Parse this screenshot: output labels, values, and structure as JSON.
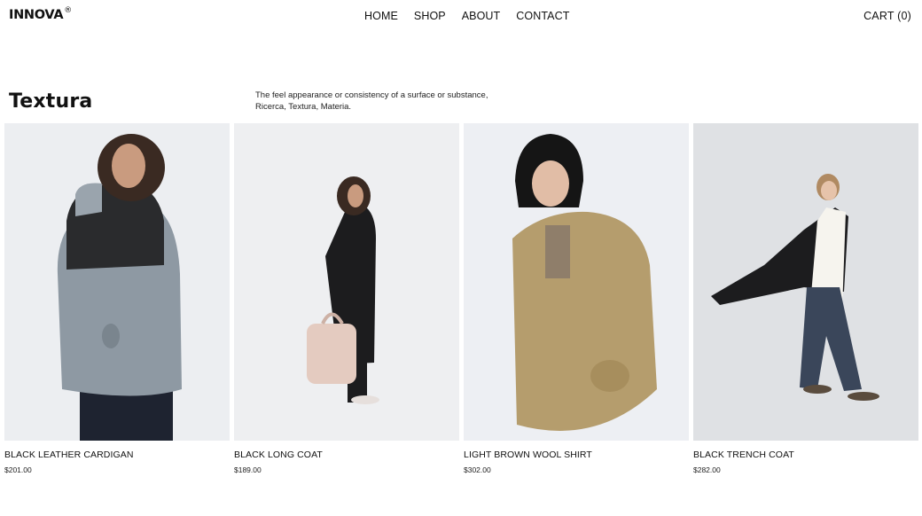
{
  "brand": {
    "name": "INNOVA",
    "mark": "®"
  },
  "nav": {
    "items": [
      "HOME",
      "SHOP",
      "ABOUT",
      "CONTACT"
    ]
  },
  "cart": {
    "label": "CART (0)"
  },
  "collection": {
    "title": "Textura",
    "description_line1": "The feel appearance or consistency of a surface or substance,",
    "description_line2": "Ricerca, Textura, Materia."
  },
  "products": [
    {
      "name": "BLACK LEATHER CARDIGAN",
      "price": "$201.00"
    },
    {
      "name": "BLACK LONG COAT",
      "price": "$189.00"
    },
    {
      "name": "LIGHT BROWN WOOL SHIRT",
      "price": "$302.00"
    },
    {
      "name": "BLACK TRENCH COAT",
      "price": "$282.00"
    }
  ],
  "colors": {
    "photo_bg": "#eeeff1",
    "text": "#111111"
  }
}
